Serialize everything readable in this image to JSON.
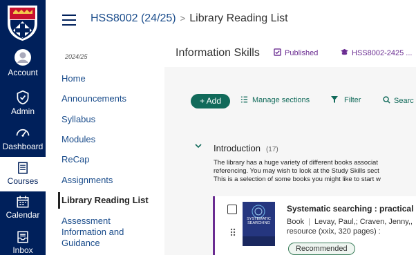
{
  "global_nav": {
    "items": [
      {
        "label": "Account",
        "icon": "account-icon"
      },
      {
        "label": "Admin",
        "icon": "shield-icon"
      },
      {
        "label": "Dashboard",
        "icon": "dashboard-icon"
      },
      {
        "label": "Courses",
        "icon": "book-icon",
        "active": true
      },
      {
        "label": "Calendar",
        "icon": "calendar-icon"
      },
      {
        "label": "Inbox",
        "icon": "inbox-icon"
      }
    ],
    "bg_color": "#00205b"
  },
  "breadcrumb": {
    "course": "HSS8002 (24/25)",
    "separator": ">",
    "page": "Library Reading List"
  },
  "course_nav": {
    "term": "2024/25",
    "items": [
      "Home",
      "Announcements",
      "Syllabus",
      "Modules",
      "ReCap",
      "Assignments",
      "Library Reading List",
      "Assessment Information and Guidance"
    ]
  },
  "list": {
    "title": "Information Skills",
    "status": "Published",
    "code": "HSS8002-2425 ...",
    "toolbar": {
      "add": "+ Add",
      "manage": "Manage sections",
      "filter": "Filter",
      "search": "Searc"
    },
    "section": {
      "name": "Introduction",
      "count": "(17)",
      "desc_lines": [
        "The library has a huge variety of different books associat",
        "referencing. You may wish to look at the Study Skills sect",
        "This is a selection of some books you might like to start w"
      ]
    },
    "item": {
      "title": "Systematic searching : practical",
      "type": "Book",
      "authors": "Levay, Paul,; Craven, Jenny,,",
      "extent": "resource (xxix, 320 pages) :",
      "badge": "Recommended",
      "cover_text": "SYSTEMATIC SEARCHING"
    },
    "colors": {
      "accent": "#6a2c91",
      "action": "#116a5a"
    }
  }
}
